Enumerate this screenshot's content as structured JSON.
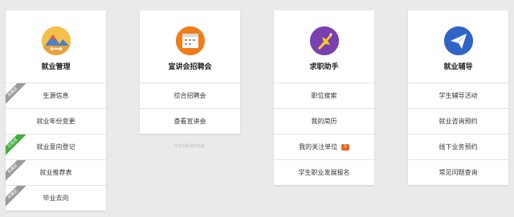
{
  "cards": [
    {
      "title": "就业管理",
      "icon": "mountain-landscape-icon",
      "icon_color": "#5b87c6",
      "items": [
        {
          "label": "生源信息",
          "ribbon": "未确定",
          "ribbon_color": "#9a9a9a"
        },
        {
          "label": "就业年份变更"
        },
        {
          "label": "就业意向登记",
          "ribbon": "已完成",
          "ribbon_color": "#3fae3f"
        },
        {
          "label": "就业推荐表",
          "ribbon": "未确定",
          "ribbon_color": "#9a9a9a"
        },
        {
          "label": "毕业去向",
          "ribbon": "未确定",
          "ribbon_color": "#9a9a9a"
        }
      ]
    },
    {
      "title": "宣讲会招聘会",
      "icon": "calendar-board-icon",
      "icon_color": "#f07d1a",
      "items": [
        {
          "label": "综合招聘会"
        },
        {
          "label": "查看宣讲会"
        }
      ],
      "note": "今日1场/明日0场"
    },
    {
      "title": "求职助手",
      "icon": "pointing-hand-icon",
      "icon_color": "#7b3fb0",
      "items": [
        {
          "label": "职位搜索"
        },
        {
          "label": "我的简历"
        },
        {
          "label": "我的关注单位",
          "badge": "0"
        },
        {
          "label": "学生职业发展报名"
        }
      ]
    },
    {
      "title": "就业辅导",
      "icon": "paper-plane-icon",
      "icon_color": "#2f63c8",
      "items": [
        {
          "label": "学生辅导活动"
        },
        {
          "label": "就业咨询预约"
        },
        {
          "label": "线下业务预约"
        },
        {
          "label": "常见问题查询"
        }
      ]
    }
  ]
}
